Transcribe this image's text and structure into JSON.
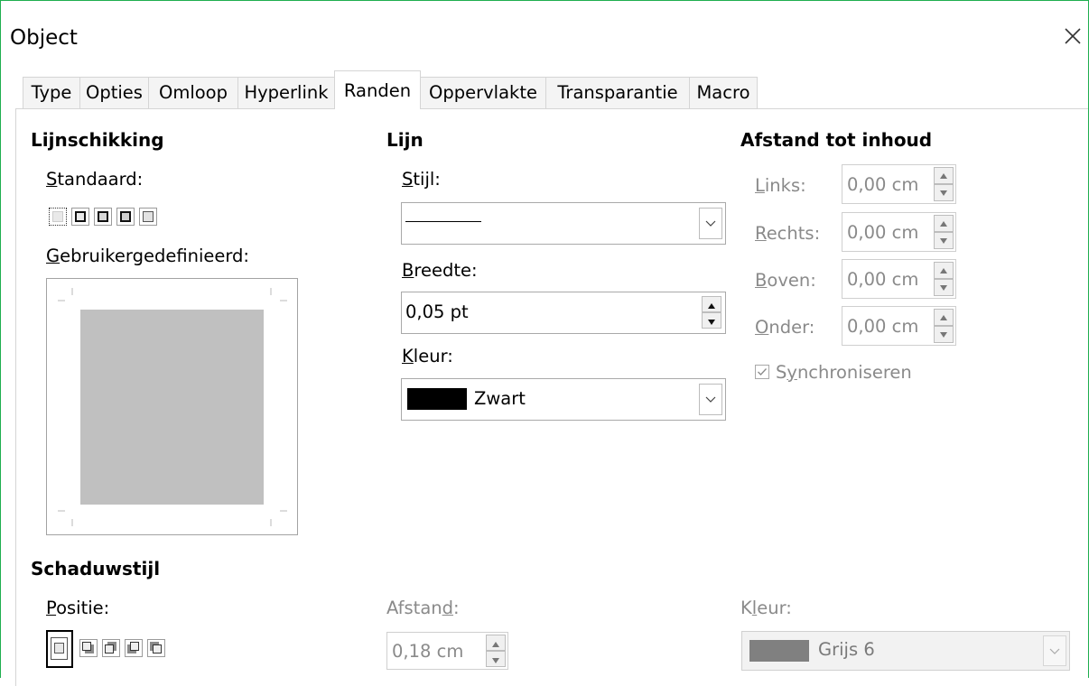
{
  "dialog": {
    "title": "Object",
    "close_icon": "close-icon"
  },
  "tabs": [
    {
      "label": "Type"
    },
    {
      "label": "Opties"
    },
    {
      "label": "Omloop"
    },
    {
      "label": "Hyperlink"
    },
    {
      "label": "Randen",
      "active": true
    },
    {
      "label": "Oppervlakte"
    },
    {
      "label": "Transparantie"
    },
    {
      "label": "Macro"
    }
  ],
  "line_arrangement": {
    "heading": "Lijnschikking",
    "default_label_u": "S",
    "default_label_rest": "tandaard:",
    "user_defined_label_u": "G",
    "user_defined_label_rest": "ebruikergedefinieerd:"
  },
  "line": {
    "heading": "Lijn",
    "style_label_u": "S",
    "style_label_rest": "tijl:",
    "width_label_u": "B",
    "width_label_rest": "reedte:",
    "width_value": "0,05 pt",
    "color_label_u": "K",
    "color_label_rest": "leur:",
    "color_value": "Zwart",
    "color_swatch": "#000000"
  },
  "spacing": {
    "heading": "Afstand tot inhoud",
    "left_label_u": "L",
    "left_label_rest": "inks:",
    "left_value": "0,00 cm",
    "right_label_u": "R",
    "right_label_rest": "echts:",
    "right_value": "0,00 cm",
    "top_label_u": "B",
    "top_label_rest": "oven:",
    "top_value": "0,00 cm",
    "bottom_label_u": "O",
    "bottom_label_rest": "nder:",
    "bottom_value": "0,00 cm",
    "sync_label_pre": "S",
    "sync_label_u": "y",
    "sync_label_rest": "nchroniseren",
    "sync_checked": true
  },
  "shadow": {
    "heading": "Schaduwstijl",
    "position_label_u": "P",
    "position_label_rest": "ositie:",
    "distance_label_pre": "Afstan",
    "distance_label_u": "d",
    "distance_label_rest": ":",
    "distance_value": "0,18 cm",
    "color_label_pre": "K",
    "color_label_u": "l",
    "color_label_rest": "eur:",
    "color_value": "Grijs 6",
    "color_swatch": "#808080"
  }
}
